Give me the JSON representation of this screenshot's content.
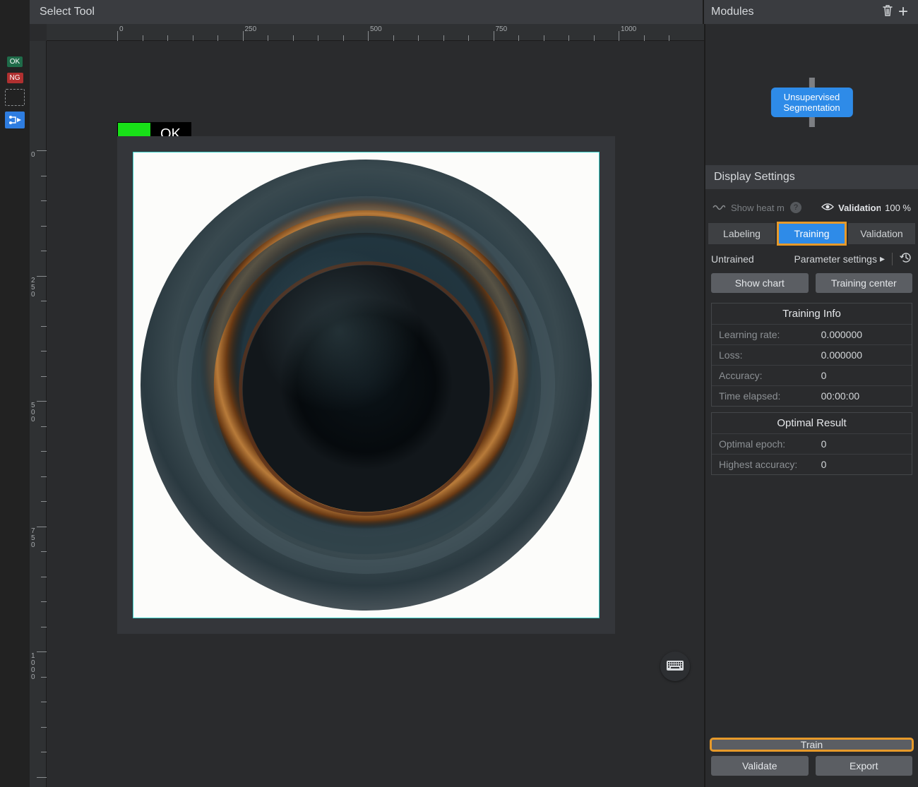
{
  "header": {
    "left_title": "Select Tool",
    "modules_title": "Modules"
  },
  "left_tools": {
    "ok_label": "OK",
    "ng_label": "NG"
  },
  "ruler": {
    "h_ticks": [
      "0",
      "250",
      "500",
      "750",
      "1000"
    ],
    "v_ticks": [
      "0",
      "250",
      "500",
      "750",
      "1000"
    ]
  },
  "canvas": {
    "label_text": "OK"
  },
  "modules": {
    "node_line1": "Unsupervised",
    "node_line2": "Segmentation"
  },
  "display_settings": {
    "header": "Display Settings",
    "heatmap_label": "Show heat m",
    "validation_label": "Validation",
    "validation_pct": "100 %"
  },
  "tabs": {
    "labeling": "Labeling",
    "training": "Training",
    "validation": "Validation"
  },
  "training": {
    "status": "Untrained",
    "param_settings": "Parameter settings",
    "show_chart": "Show chart",
    "training_center": "Training center",
    "info_title": "Training Info",
    "learning_rate_k": "Learning rate:",
    "learning_rate_v": "0.000000",
    "loss_k": "Loss:",
    "loss_v": "0.000000",
    "accuracy_k": "Accuracy:",
    "accuracy_v": "0",
    "time_k": "Time elapsed:",
    "time_v": "00:00:00",
    "optimal_title": "Optimal Result",
    "opt_epoch_k": "Optimal epoch:",
    "opt_epoch_v": "0",
    "high_acc_k": "Highest accuracy:",
    "high_acc_v": "0",
    "train_btn": "Train",
    "validate_btn": "Validate",
    "export_btn": "Export"
  }
}
